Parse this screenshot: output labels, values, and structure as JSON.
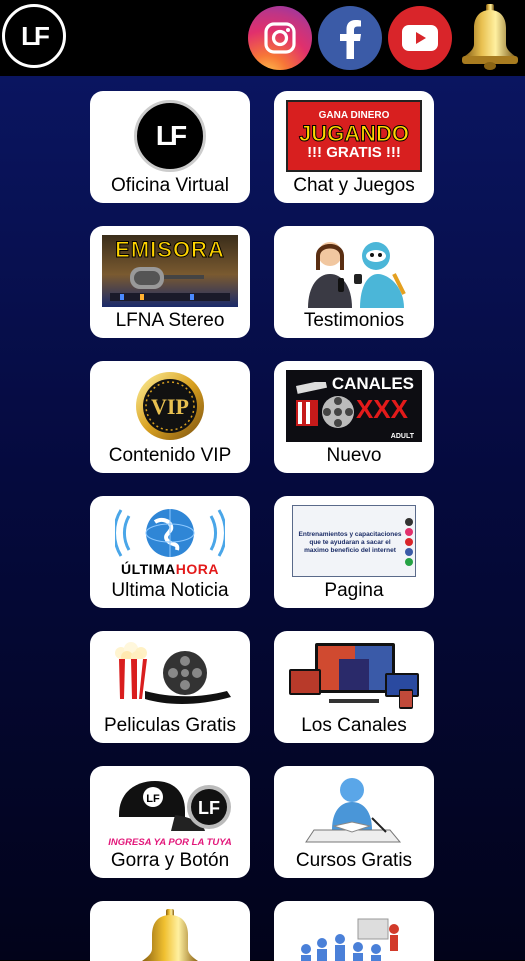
{
  "header": {
    "logo_text": "LF",
    "social": [
      {
        "name": "Instagram",
        "icon": "instagram-icon",
        "color": "#e1306c"
      },
      {
        "name": "Facebook",
        "icon": "facebook-icon",
        "color": "#3b5ba7"
      },
      {
        "name": "YouTube",
        "icon": "youtube-icon",
        "color": "#d9252a"
      }
    ],
    "notification_icon": "bell-icon"
  },
  "tiles": [
    {
      "label": "Oficina Virtual",
      "icon": "lf-logo-icon",
      "art_text": "LF"
    },
    {
      "label": "Chat y Juegos",
      "icon": "gana-dinero-banner",
      "art_text": [
        "GANA DINERO",
        "JUGANDO",
        "!!! GRATIS !!!"
      ]
    },
    {
      "label": "LFNA Stereo",
      "icon": "emisora-radio-banner",
      "art_text": "EMISORA"
    },
    {
      "label": "Testimonios",
      "icon": "testimonial-people-icon"
    },
    {
      "label": "Contenido VIP",
      "icon": "vip-badge-icon",
      "art_text": "VIP"
    },
    {
      "label": "Nuevo",
      "icon": "canales-xxx-banner",
      "art_text": [
        "CANALES",
        "XXX",
        "ADULT"
      ]
    },
    {
      "label": "Ultima Noticia",
      "icon": "ultima-hora-globe-icon",
      "art_text": [
        "ÚLTIMA",
        "HORA"
      ]
    },
    {
      "label": "Pagina",
      "icon": "website-screenshot",
      "art_text": "Entrenamientos y capacitaciones que te ayudaran a sacar el maximo beneficio del internet"
    },
    {
      "label": "Peliculas Gratis",
      "icon": "popcorn-film-icon"
    },
    {
      "label": "Los Canales",
      "icon": "tv-devices-icon"
    },
    {
      "label": "Gorra y Botón",
      "icon": "cap-button-icon",
      "art_text": [
        "LF",
        "LF",
        "INGRESA YA POR LA TUYA"
      ]
    },
    {
      "label": "Cursos Gratis",
      "icon": "student-desk-icon"
    },
    {
      "label": "",
      "icon": "bell-icon"
    },
    {
      "label": "",
      "icon": "classroom-people-icon"
    }
  ]
}
